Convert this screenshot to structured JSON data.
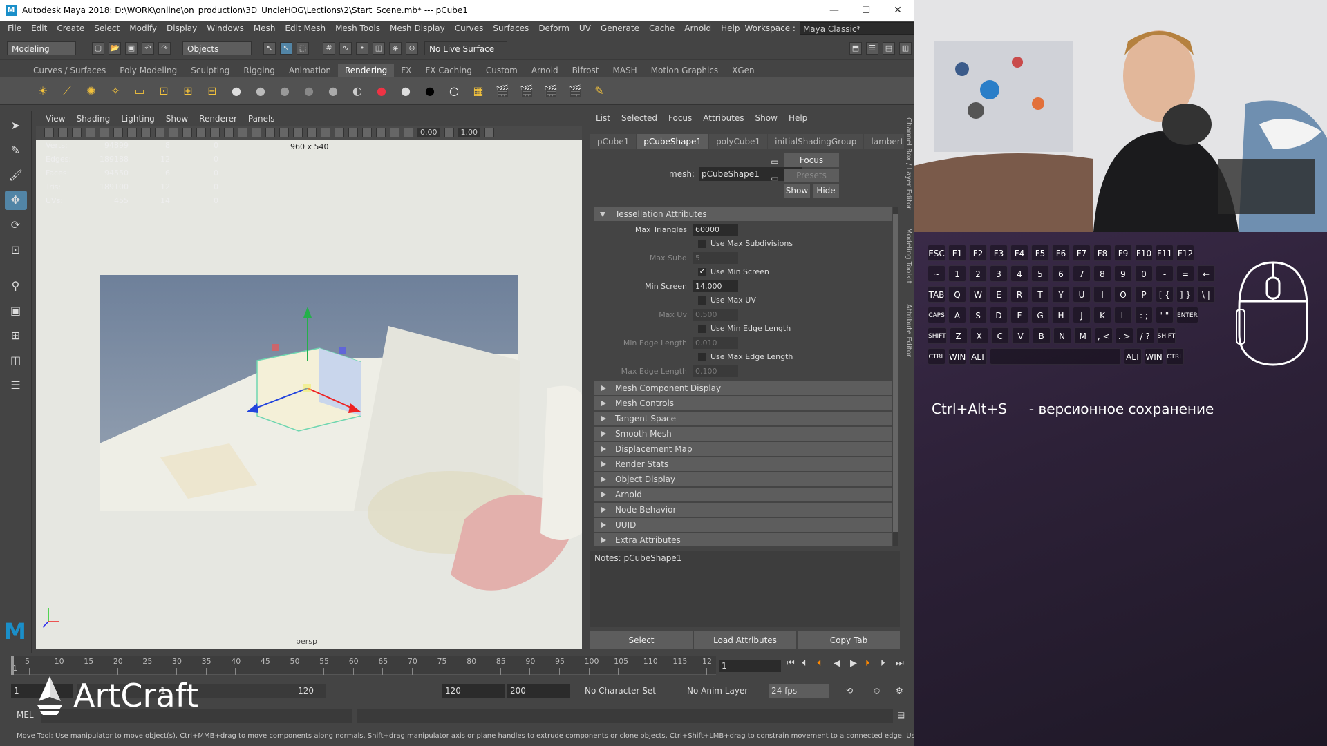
{
  "window": {
    "title": "Autodesk Maya 2018: D:\\WORK\\online\\on_production\\3D_UncleHOG\\Lections\\2\\Start_Scene.mb*   ---   pCube1",
    "min": "—",
    "max": "☐",
    "close": "✕"
  },
  "menus": [
    "File",
    "Edit",
    "Create",
    "Select",
    "Modify",
    "Display",
    "Windows",
    "Mesh",
    "Edit Mesh",
    "Mesh Tools",
    "Mesh Display",
    "Curves",
    "Surfaces",
    "Deform",
    "UV",
    "Generate",
    "Cache",
    "Arnold",
    "Help"
  ],
  "workspace": {
    "label": "Workspace :",
    "value": "Maya Classic*"
  },
  "statusline": {
    "mode": "Modeling",
    "objects": "Objects",
    "live": "No Live Surface"
  },
  "shelf_tabs": [
    "Curves / Surfaces",
    "Poly Modeling",
    "Sculpting",
    "Rigging",
    "Animation",
    "Rendering",
    "FX",
    "FX Caching",
    "Custom",
    "Arnold",
    "Bifrost",
    "MASH",
    "Motion Graphics",
    "XGen"
  ],
  "active_shelf": "Rendering",
  "viewport": {
    "menus": [
      "View",
      "Shading",
      "Lighting",
      "Show",
      "Renderer",
      "Panels"
    ],
    "exposure": "0.00",
    "gamma": "1.00",
    "hud": [
      {
        "k": "Verts:",
        "a": "94899",
        "b": "8",
        "c": "0"
      },
      {
        "k": "Edges:",
        "a": "189188",
        "b": "12",
        "c": "0"
      },
      {
        "k": "Faces:",
        "a": "94550",
        "b": "6",
        "c": "0"
      },
      {
        "k": "Tris:",
        "a": "189100",
        "b": "12",
        "c": "0"
      },
      {
        "k": "UVs:",
        "a": "455",
        "b": "14",
        "c": "0"
      }
    ],
    "resolution": "960 x 540",
    "camera": "persp"
  },
  "attr": {
    "menus": [
      "List",
      "Selected",
      "Focus",
      "Attributes",
      "Show",
      "Help"
    ],
    "tabs": [
      "pCube1",
      "pCubeShape1",
      "polyCube1",
      "initialShadingGroup",
      "lambert1"
    ],
    "active_tab": "pCubeShape1",
    "mesh_label": "mesh:",
    "mesh_value": "pCubeShape1",
    "focus": "Focus",
    "presets": "Presets",
    "show": "Show",
    "hide": "Hide",
    "open_section": "Tessellation Attributes",
    "tess": {
      "max_triangles_label": "Max Triangles",
      "max_triangles": "60000",
      "use_max_subdiv": "Use Max Subdivisions",
      "max_subd_label": "Max Subd",
      "max_subd": "5",
      "use_min_screen": "Use Min Screen",
      "min_screen_label": "Min Screen",
      "min_screen": "14.000",
      "use_max_uv": "Use Max UV",
      "max_uv_label": "Max Uv",
      "max_uv": "0.500",
      "use_min_edge": "Use Min Edge Length",
      "min_edge_label": "Min Edge Length",
      "min_edge": "0.010",
      "use_max_edge": "Use Max Edge Length",
      "max_edge_label": "Max Edge Length",
      "max_edge": "0.100"
    },
    "sections": [
      "Mesh Component Display",
      "Mesh Controls",
      "Tangent Space",
      "Smooth Mesh",
      "Displacement Map",
      "Render Stats",
      "Object Display",
      "Arnold",
      "Node Behavior",
      "UUID",
      "Extra Attributes"
    ],
    "notes": "Notes:  pCubeShape1",
    "buttons": [
      "Select",
      "Load Attributes",
      "Copy Tab"
    ]
  },
  "sidetabs": [
    "Channel Box / Layer Editor",
    "Modeling Toolkit",
    "Attribute Editor"
  ],
  "timeline": {
    "ticks": [
      "5",
      "10",
      "15",
      "20",
      "25",
      "30",
      "35",
      "40",
      "45",
      "50",
      "55",
      "60",
      "65",
      "70",
      "75",
      "80",
      "85",
      "90",
      "95",
      "100",
      "105",
      "110",
      "115",
      "12"
    ],
    "start": "1",
    "current": "1"
  },
  "range": {
    "start": "1",
    "inner_start": "1",
    "inner_end": "120",
    "end": "120",
    "max": "200",
    "character_set": "No Character Set",
    "anim_layer": "No Anim Layer",
    "fps": "24 fps"
  },
  "cmd": {
    "lang": "MEL"
  },
  "helpline": "Move Tool: Use manipulator to move object(s). Ctrl+MMB+drag to move components along normals. Shift+drag manipulator axis or plane handles to extrude components or clone objects. Ctrl+Shift+LMB+drag to constrain movement to a connected edge. Use D or INSERT to change the pivot",
  "brand": "ArtCraft",
  "keyboard": [
    [
      "ESC",
      "F1",
      "F2",
      "F3",
      "F4",
      "F5",
      "F6",
      "F7",
      "F8",
      "F9",
      "F10",
      "F11",
      "F12"
    ],
    [
      "~",
      "1",
      "2",
      "3",
      "4",
      "5",
      "6",
      "7",
      "8",
      "9",
      "0",
      "-",
      "=",
      "←"
    ],
    [
      "TAB",
      "Q",
      "W",
      "E",
      "R",
      "T",
      "Y",
      "U",
      "I",
      "O",
      "P",
      "[ {",
      "] }",
      "\\ |"
    ],
    [
      "CAPS",
      "A",
      "S",
      "D",
      "F",
      "G",
      "H",
      "J",
      "K",
      "L",
      ": ;",
      "' \"",
      "ENTER"
    ],
    [
      "SHIFT",
      "Z",
      "X",
      "C",
      "V",
      "B",
      "N",
      "M",
      ", <",
      ". >",
      "/ ?",
      "SHIFT"
    ],
    [
      "CTRL",
      "WIN",
      "ALT",
      "",
      "ALT",
      "WIN",
      "CTRL"
    ]
  ],
  "hotkey": {
    "combo": "Ctrl+Alt+S",
    "desc": "- версионное сохранение"
  }
}
